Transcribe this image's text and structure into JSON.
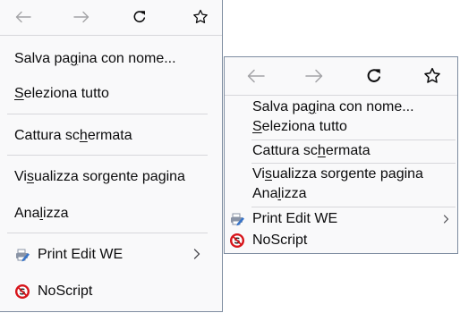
{
  "menu_large": {
    "items": [
      {
        "pre": "Salva pa",
        "key": "g",
        "post": "ina con nome..."
      },
      {
        "pre": "",
        "key": "S",
        "post": "eleziona tutto"
      },
      {
        "pre": "Cattura sc",
        "key": "h",
        "post": "ermata"
      },
      {
        "pre": "Vi",
        "key": "s",
        "post": "ualizza sorgente pagina"
      },
      {
        "pre": "Ana",
        "key": "l",
        "post": "izza"
      }
    ],
    "extensions": [
      {
        "label": "Print Edit WE",
        "icon": "print-edit-icon",
        "has_submenu": true
      },
      {
        "label": "NoScript",
        "icon": "noscript-icon",
        "has_submenu": false
      }
    ]
  },
  "menu_compact": {
    "items": [
      {
        "pre": "Salva pa",
        "key": "g",
        "post": "ina con nome..."
      },
      {
        "pre": "",
        "key": "S",
        "post": "eleziona tutto"
      },
      {
        "pre": "Cattura sc",
        "key": "h",
        "post": "ermata"
      },
      {
        "pre": "Vi",
        "key": "s",
        "post": "ualizza sorgente pagina"
      },
      {
        "pre": "Ana",
        "key": "l",
        "post": "izza"
      }
    ],
    "extensions": [
      {
        "label": "Print Edit WE",
        "icon": "print-edit-icon",
        "has_submenu": true
      },
      {
        "label": "NoScript",
        "icon": "noscript-icon",
        "has_submenu": false
      }
    ]
  },
  "nav_icons": [
    "back-arrow-icon",
    "forward-arrow-icon",
    "reload-icon",
    "bookmark-star-icon"
  ],
  "colors": {
    "menu_bg": "#f9f9fa",
    "border": "#7e8ca0",
    "separator": "#d7d7db",
    "text": "#0c0c0d",
    "icon_disabled": "#a3a3a6",
    "noscript_red": "#d7141a",
    "print_blue": "#3874c8"
  }
}
